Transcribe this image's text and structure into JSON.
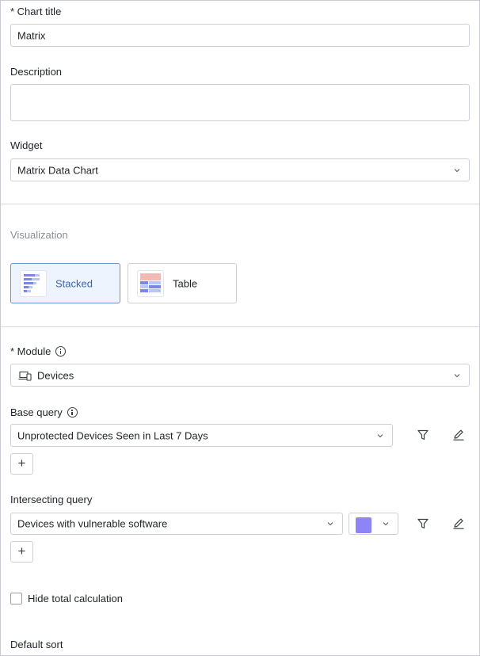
{
  "form": {
    "chart_title": {
      "label": "* Chart title",
      "value": "Matrix"
    },
    "description": {
      "label": "Description",
      "value": ""
    },
    "widget": {
      "label": "Widget",
      "value": "Matrix Data Chart"
    },
    "visualization": {
      "label": "Visualization",
      "options": [
        {
          "label": "Stacked",
          "selected": true
        },
        {
          "label": "Table",
          "selected": false
        }
      ]
    },
    "module": {
      "label": "* Module",
      "value": "Devices"
    },
    "base_query": {
      "label": "Base query",
      "value": "Unprotected Devices Seen in Last 7 Days"
    },
    "intersecting_query": {
      "label": "Intersecting query",
      "value": "Devices with vulnerable software",
      "color": "#8f84f5"
    },
    "hide_total": {
      "label": "Hide total calculation",
      "checked": false
    },
    "default_sort": {
      "label": "Default sort"
    }
  },
  "add_label": "+",
  "icons": {
    "chevron": "chevron-down-icon",
    "info": "info-icon",
    "filter": "filter-icon",
    "edit": "pencil-icon",
    "devices": "devices-icon"
  }
}
